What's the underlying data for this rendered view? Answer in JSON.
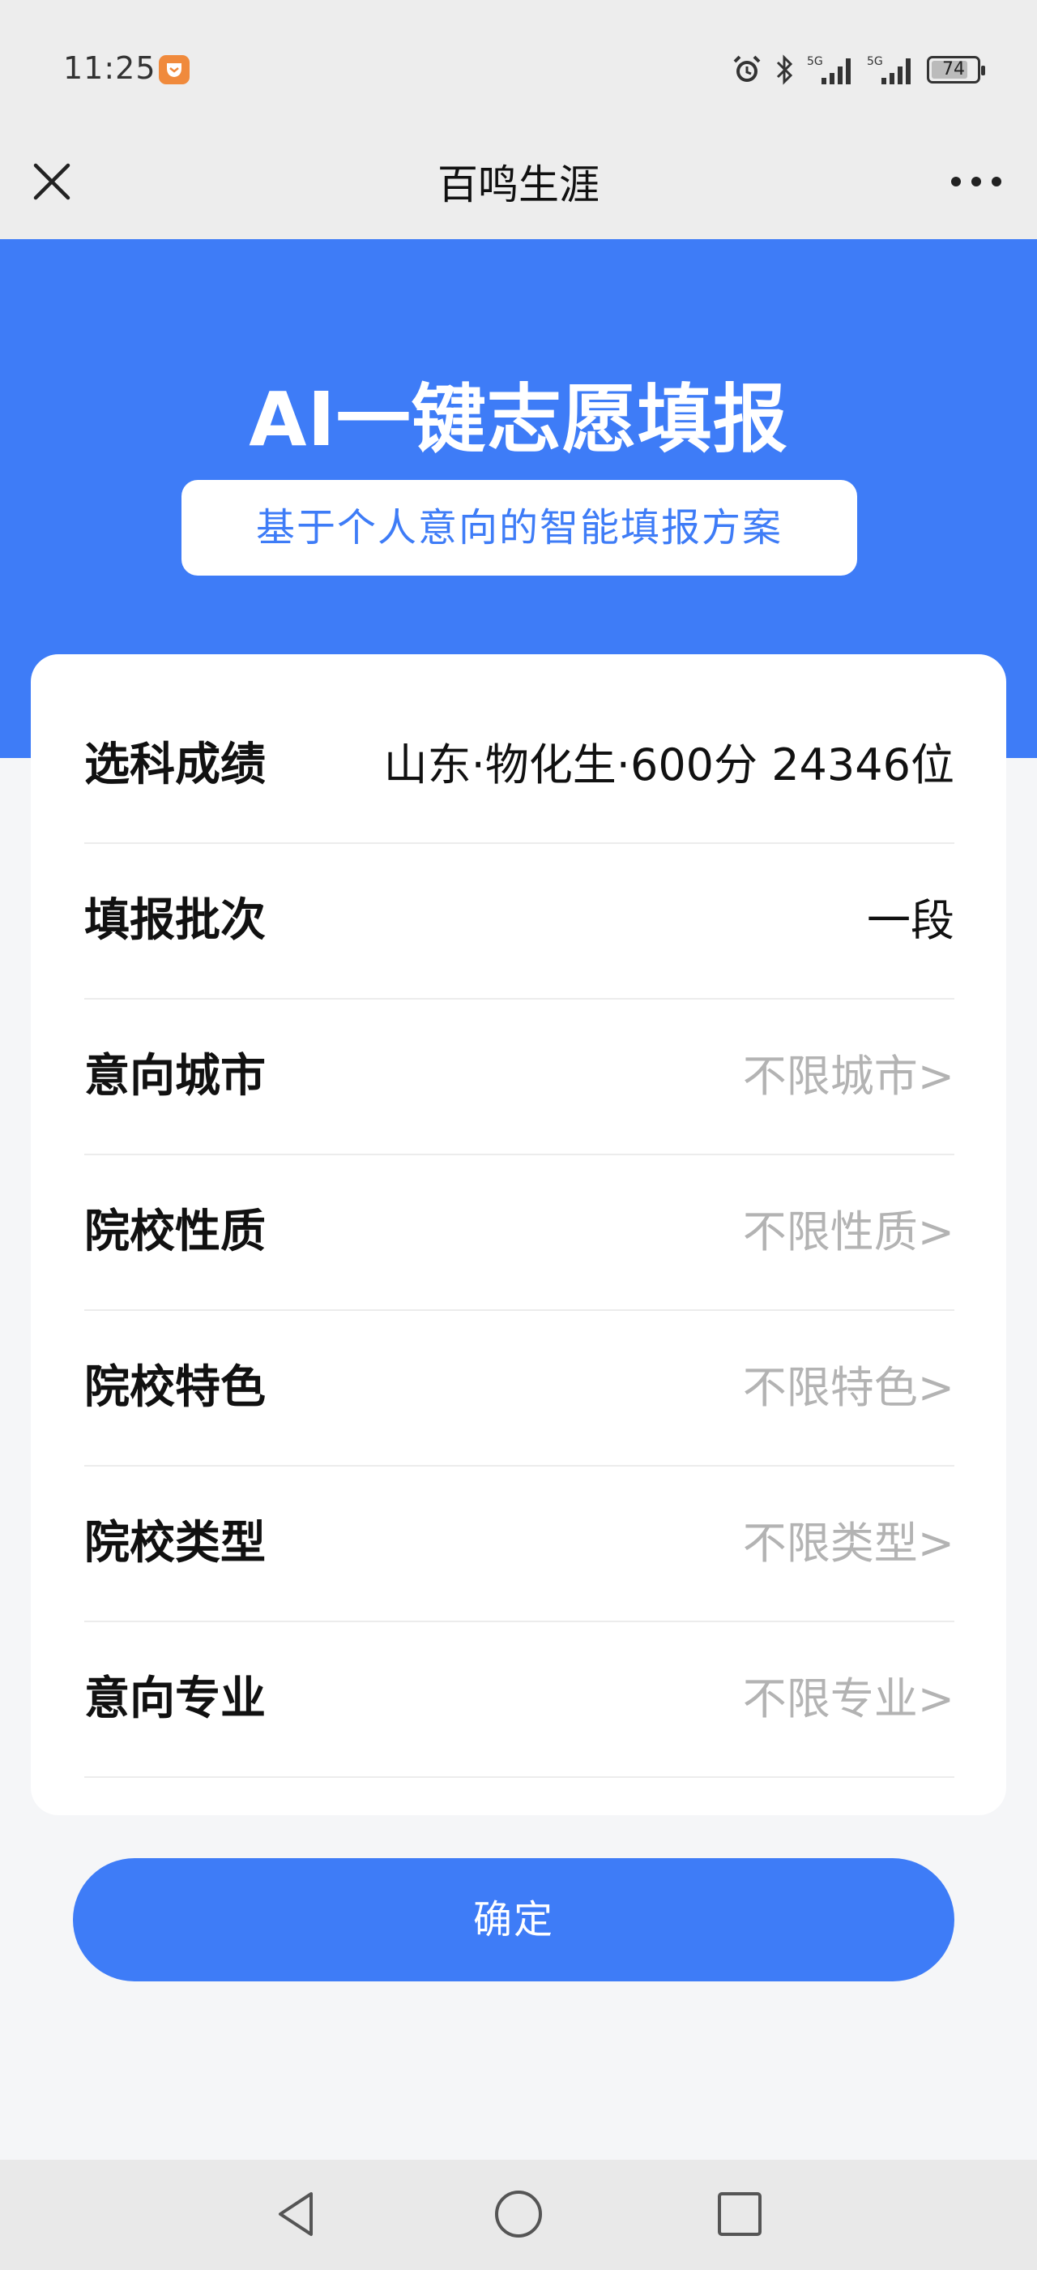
{
  "status_bar": {
    "time": "11:25",
    "battery": "74",
    "network_1": "5G",
    "network_2": "5G"
  },
  "nav": {
    "title": "百鸣生涯"
  },
  "hero": {
    "title": "AI一键志愿填报",
    "subtitle": "基于个人意向的智能填报方案"
  },
  "form": {
    "rows": [
      {
        "label": "选科成绩",
        "value": "山东·物化生·600分 24346位"
      },
      {
        "label": "填报批次",
        "value": "一段"
      },
      {
        "label": "意向城市",
        "value": "不限城市>"
      },
      {
        "label": "院校性质",
        "value": "不限性质>"
      },
      {
        "label": "院校特色",
        "value": "不限特色>"
      },
      {
        "label": "院校类型",
        "value": "不限类型>"
      },
      {
        "label": "意向专业",
        "value": "不限专业>"
      }
    ]
  },
  "confirm_label": "确定",
  "colors": {
    "accent": "#3e7cf7",
    "muted_text": "#b3b3b3",
    "page_bg": "#f5f6f8"
  }
}
